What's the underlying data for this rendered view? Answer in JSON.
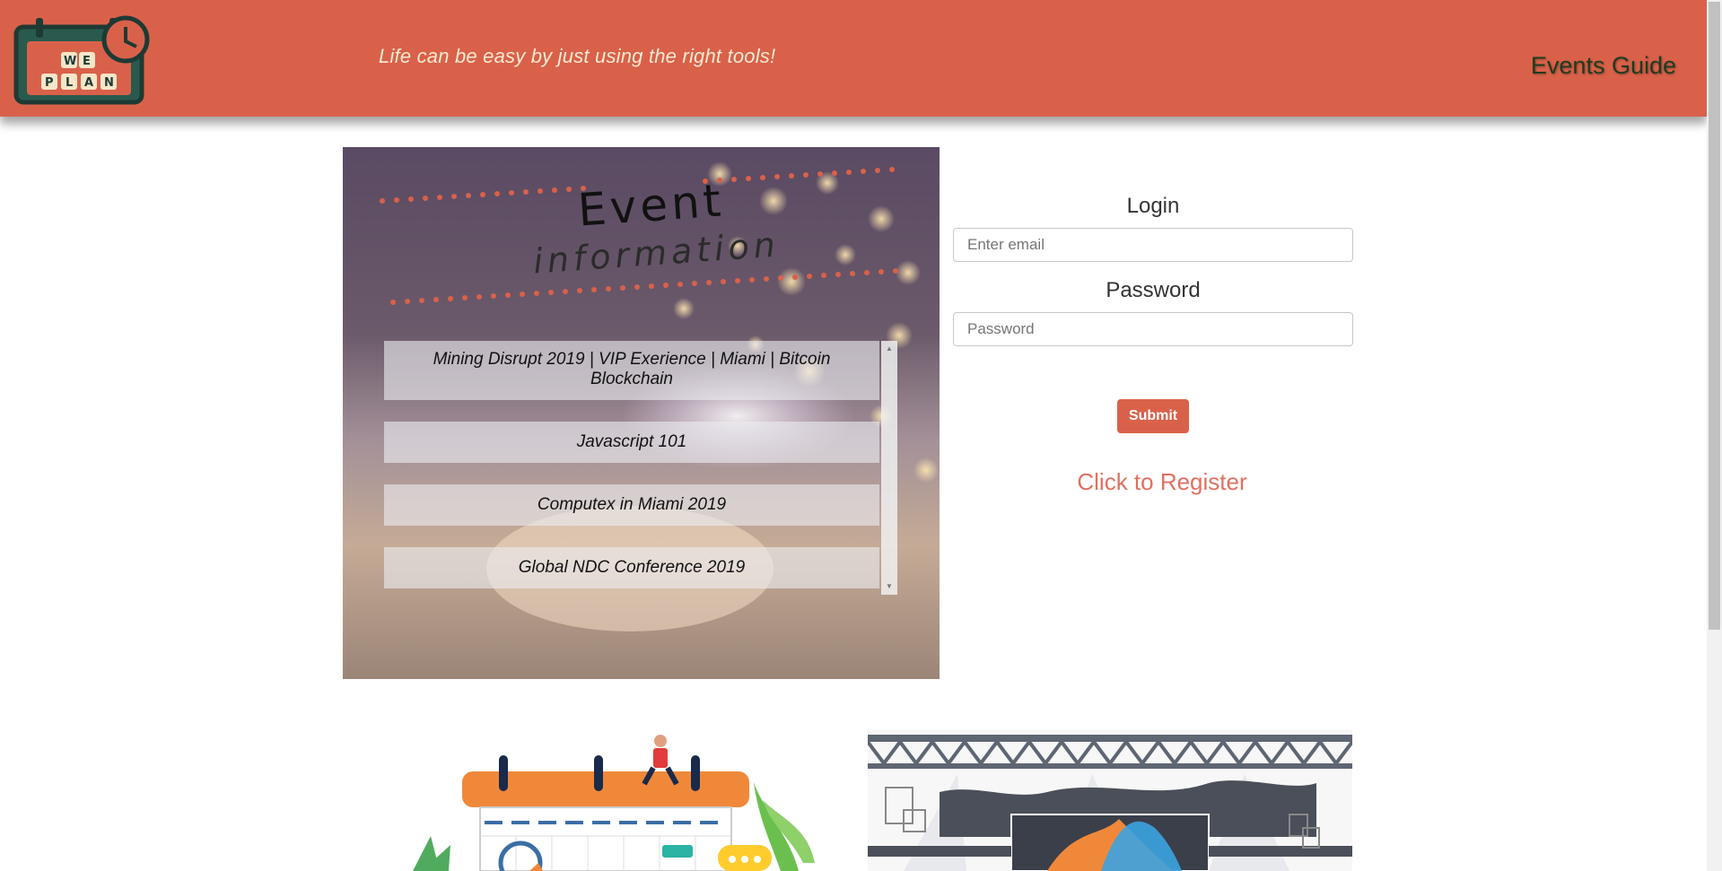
{
  "header": {
    "logo_text_top": "WE",
    "logo_text_bottom": "PLAN",
    "tagline": "Life can be easy by just using the right tools!",
    "nav_link": "Events Guide"
  },
  "event_panel": {
    "title": "Event",
    "subtitle": "information",
    "events": [
      "Mining Disrupt 2019 | VIP Exerience | Miami | Bitcoin Blockchain",
      "Javascript 101",
      "Computex in Miami 2019",
      "Global NDC Conference 2019"
    ]
  },
  "login": {
    "login_label": "Login",
    "email_placeholder": "Enter email",
    "password_label": "Password",
    "password_placeholder": "Password",
    "submit_label": "Submit",
    "register_link": "Click to Register"
  },
  "colors": {
    "brand": "#d9614a",
    "accent_link": "#e07060",
    "nav_text": "#1d3c1f"
  }
}
